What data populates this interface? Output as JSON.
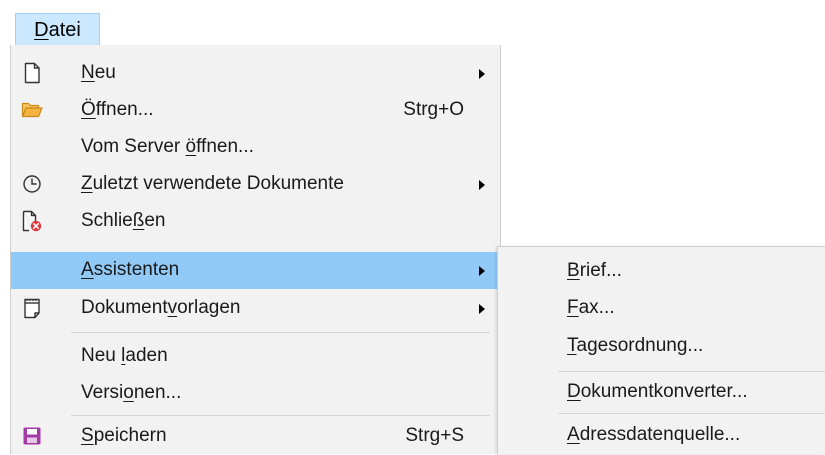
{
  "menubar": {
    "file": {
      "pre": "",
      "mn": "D",
      "post": "atei"
    }
  },
  "menu": {
    "items": [
      {
        "pre": "",
        "mn": "N",
        "post": "eu",
        "icon": "new-document-icon"
      },
      {
        "pre": "",
        "mn": "Ö",
        "post": "ffnen...",
        "shortcut": "Strg+O",
        "icon": "open-folder-icon"
      },
      {
        "pre": "Vom Server ",
        "mn": "ö",
        "post": "ffnen..."
      },
      {
        "pre": "",
        "mn": "Z",
        "post": "uletzt verwendete Dokumente",
        "icon": "recent-clock-icon"
      },
      {
        "pre": "Schlie",
        "mn": "ß",
        "post": "en",
        "icon": "close-document-icon"
      },
      {
        "pre": "",
        "mn": "A",
        "post": "ssistenten"
      },
      {
        "pre": "Dokument",
        "mn": "v",
        "post": "orlagen",
        "icon": "templates-icon"
      },
      {
        "pre": "Neu ",
        "mn": "l",
        "post": "aden"
      },
      {
        "pre": "Versi",
        "mn": "o",
        "post": "nen..."
      },
      {
        "pre": "",
        "mn": "S",
        "post": "peichern",
        "shortcut": "Strg+S",
        "icon": "save-icon"
      }
    ]
  },
  "submenu": {
    "items": [
      {
        "pre": "",
        "mn": "B",
        "post": "rief..."
      },
      {
        "pre": "",
        "mn": "F",
        "post": "ax..."
      },
      {
        "pre": "",
        "mn": "T",
        "post": "agesordnung..."
      },
      {
        "pre": "",
        "mn": "D",
        "post": "okumentkonverter..."
      },
      {
        "pre": "",
        "mn": "A",
        "post": "dressdatenquelle..."
      }
    ]
  },
  "colors": {
    "highlight": "#91c9f7",
    "menubar_active": "#cce8ff",
    "menu_background": "#f2f2f2",
    "open_icon": "#f5b342",
    "close_icon_badge": "#e0393e",
    "save_icon": "#a23ba5"
  }
}
